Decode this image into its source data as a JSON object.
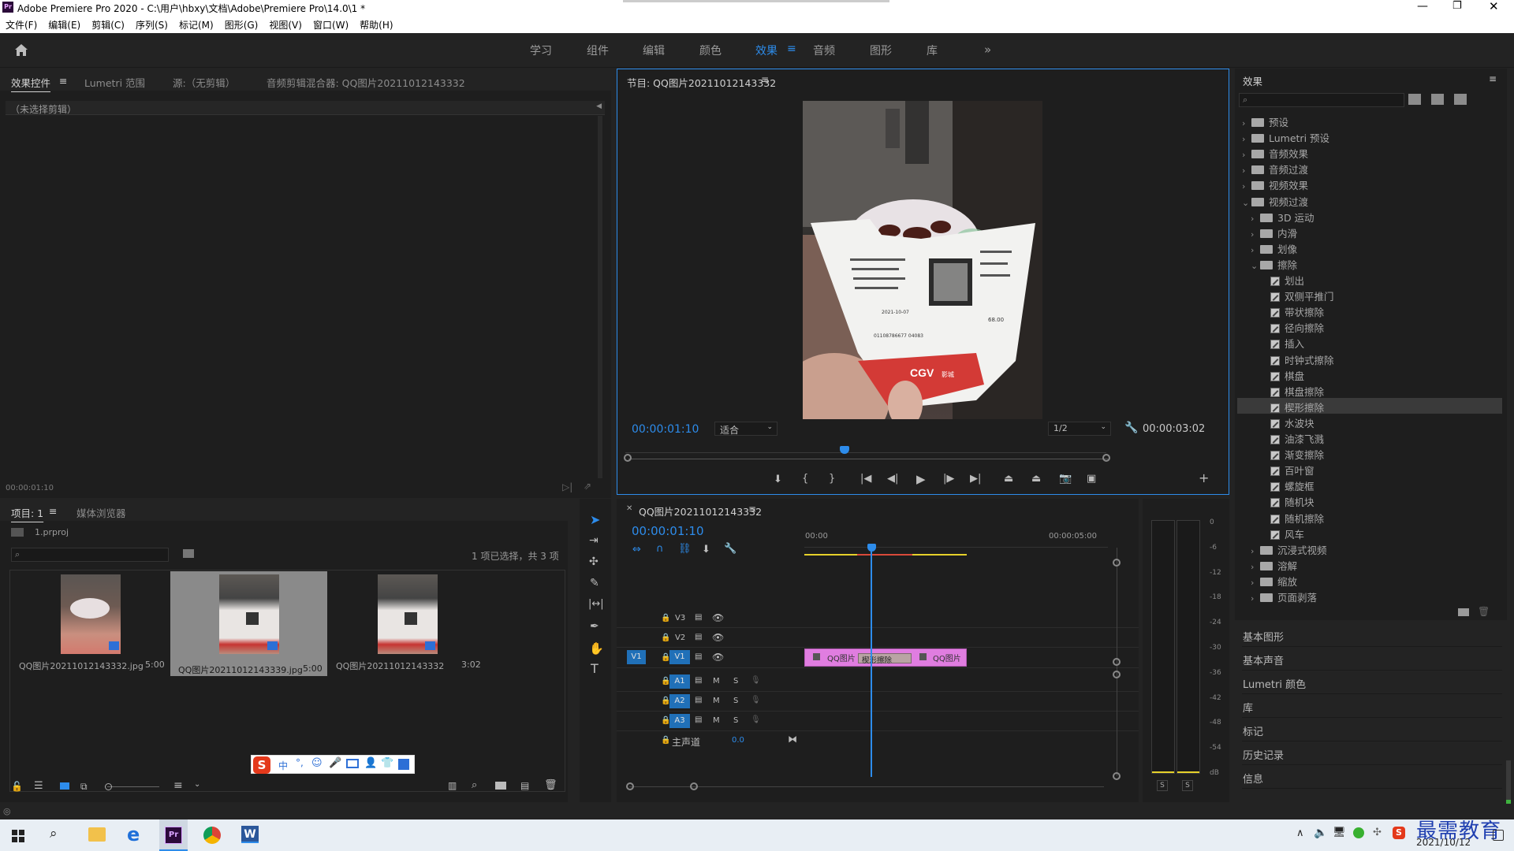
{
  "window": {
    "app_icon": "Pr",
    "title": "Adobe Premiere Pro 2020 - C:\\用户\\hbxy\\文档\\Adobe\\Premiere Pro\\14.0\\1 *"
  },
  "menu": [
    "文件(F)",
    "编辑(E)",
    "剪辑(C)",
    "序列(S)",
    "标记(M)",
    "图形(G)",
    "视图(V)",
    "窗口(W)",
    "帮助(H)"
  ],
  "workspaces": [
    "学习",
    "组件",
    "编辑",
    "颜色",
    "效果",
    "音频",
    "图形",
    "库"
  ],
  "workspace_active": "效果",
  "source_panel": {
    "tabs": [
      "效果控件",
      "Lumetri 范围",
      "源:（无剪辑）",
      "音频剪辑混合器: QQ图片20211012143332"
    ],
    "no_clip": "（未选择剪辑）",
    "timecode": "00:00:01:10"
  },
  "program": {
    "title": "节目: QQ图片20211012143332",
    "timecode": "00:00:01:10",
    "fit": "适合",
    "resolution": "1/2",
    "duration": "00:00:03:02",
    "playhead_fraction": 0.45,
    "receipt_texts": [
      "CGV",
      "影城",
      "01108786677 04083",
      "68.00",
      "2021-10-07"
    ]
  },
  "project": {
    "tabs": [
      "项目: 1",
      "媒体浏览器"
    ],
    "file": "1.prproj",
    "selection_info": "1 项已选择，共 3 项",
    "items": [
      {
        "name": "QQ图片20211012143332.jpg",
        "dur": "5:00"
      },
      {
        "name": "QQ图片20211012143339.jpg",
        "dur": "5:00"
      },
      {
        "name": "QQ图片20211012143332",
        "dur": "3:02"
      }
    ]
  },
  "timeline": {
    "tab": "QQ图片20211012143332",
    "timecode": "00:00:01:10",
    "ruler": [
      "00:00",
      "00:00:05:00"
    ],
    "video_tracks": [
      "V3",
      "V2",
      "V1"
    ],
    "source_patch": "V1",
    "audio_tracks": [
      "A1",
      "A2",
      "A3"
    ],
    "mute": "M",
    "solo": "S",
    "master": "主声道",
    "master_value": "0.0",
    "clip_a": "QQ图片",
    "clip_b": "QQ图片",
    "transition": "楔形擦除",
    "playhead_fraction": 0.22
  },
  "meter": {
    "scale": [
      "0",
      "-6",
      "-12",
      "-18",
      "-24",
      "-30",
      "-36",
      "-42",
      "-48",
      "-54",
      "dB"
    ],
    "solo": [
      "S",
      "S"
    ]
  },
  "effects": {
    "title": "效果",
    "tree": [
      {
        "label": "预设",
        "level": 0,
        "type": "bin",
        "open": false
      },
      {
        "label": "Lumetri 预设",
        "level": 0,
        "type": "bin",
        "open": false
      },
      {
        "label": "音频效果",
        "level": 0,
        "type": "folder",
        "open": false
      },
      {
        "label": "音频过渡",
        "level": 0,
        "type": "folder",
        "open": false
      },
      {
        "label": "视频效果",
        "level": 0,
        "type": "folder",
        "open": false
      },
      {
        "label": "视频过渡",
        "level": 0,
        "type": "folder",
        "open": true
      },
      {
        "label": "3D 运动",
        "level": 1,
        "type": "folder",
        "open": false
      },
      {
        "label": "内滑",
        "level": 1,
        "type": "folder",
        "open": false
      },
      {
        "label": "划像",
        "level": 1,
        "type": "folder",
        "open": false
      },
      {
        "label": "擦除",
        "level": 1,
        "type": "folder",
        "open": true
      },
      {
        "label": "划出",
        "level": 2,
        "type": "fx"
      },
      {
        "label": "双侧平推门",
        "level": 2,
        "type": "fx"
      },
      {
        "label": "带状擦除",
        "level": 2,
        "type": "fx"
      },
      {
        "label": "径向擦除",
        "level": 2,
        "type": "fx"
      },
      {
        "label": "插入",
        "level": 2,
        "type": "fx"
      },
      {
        "label": "时钟式擦除",
        "level": 2,
        "type": "fx"
      },
      {
        "label": "棋盘",
        "level": 2,
        "type": "fx"
      },
      {
        "label": "棋盘擦除",
        "level": 2,
        "type": "fx"
      },
      {
        "label": "楔形擦除",
        "level": 2,
        "type": "fx",
        "selected": true
      },
      {
        "label": "水波块",
        "level": 2,
        "type": "fx"
      },
      {
        "label": "油漆飞溅",
        "level": 2,
        "type": "fx"
      },
      {
        "label": "渐变擦除",
        "level": 2,
        "type": "fx"
      },
      {
        "label": "百叶窗",
        "level": 2,
        "type": "fx"
      },
      {
        "label": "螺旋框",
        "level": 2,
        "type": "fx"
      },
      {
        "label": "随机块",
        "level": 2,
        "type": "fx"
      },
      {
        "label": "随机擦除",
        "level": 2,
        "type": "fx"
      },
      {
        "label": "风车",
        "level": 2,
        "type": "fx"
      },
      {
        "label": "沉浸式视频",
        "level": 1,
        "type": "folder",
        "open": false
      },
      {
        "label": "溶解",
        "level": 1,
        "type": "folder",
        "open": false
      },
      {
        "label": "缩放",
        "level": 1,
        "type": "folder",
        "open": false
      },
      {
        "label": "页面剥落",
        "level": 1,
        "type": "folder",
        "open": false
      }
    ]
  },
  "side_panels": [
    "基本图形",
    "基本声音",
    "Lumetri 颜色",
    "库",
    "标记",
    "历史记录",
    "信息"
  ],
  "ime": {
    "label": "中"
  },
  "taskbar": {
    "time": "",
    "date": "2021/10/12",
    "watermark": "最需教育"
  },
  "colors": {
    "accent": "#2d8ceb",
    "clip": "#e07de0",
    "selected_row": "#3a3a3a"
  }
}
